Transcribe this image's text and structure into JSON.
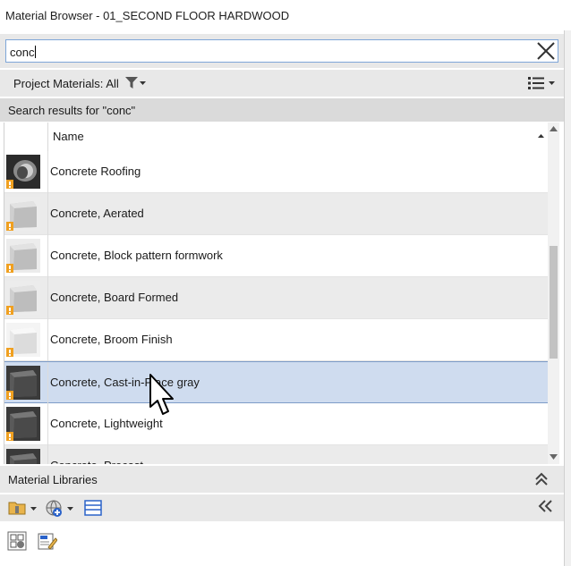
{
  "window": {
    "title": "Material Browser - 01_SECOND FLOOR HARDWOOD"
  },
  "search": {
    "value": "conc"
  },
  "filter": {
    "label": "Project Materials: All"
  },
  "results": {
    "header": "Search results for \"conc\""
  },
  "grid": {
    "column_name": "Name",
    "rows": [
      {
        "name": "Concrete Roofing",
        "swatch": "roofing"
      },
      {
        "name": "Concrete, Aerated",
        "swatch": "light"
      },
      {
        "name": "Concrete, Block pattern formwork",
        "swatch": "light"
      },
      {
        "name": "Concrete, Board Formed",
        "swatch": "light"
      },
      {
        "name": "Concrete, Broom Finish",
        "swatch": "white"
      },
      {
        "name": "Concrete, Cast-in-Place gray",
        "swatch": "dark",
        "selected": true
      },
      {
        "name": "Concrete, Lightweight",
        "swatch": "dark"
      },
      {
        "name": "Concrete, Precast",
        "swatch": "dark"
      }
    ]
  },
  "libraries": {
    "label": "Material Libraries"
  },
  "colors": {
    "selection": "#cfdcef",
    "selection_border": "#7d9cc8",
    "warning": "#f0a020"
  }
}
